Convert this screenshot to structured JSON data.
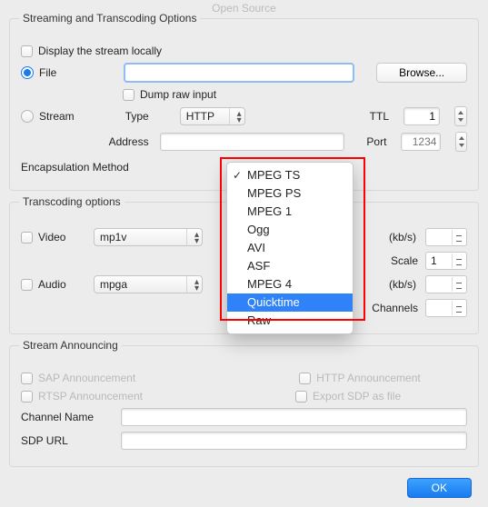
{
  "title": "Open Source",
  "stream_group": {
    "legend": "Streaming and Transcoding Options",
    "display_locally": "Display the stream locally",
    "file_label": "File",
    "browse": "Browse...",
    "dump_raw": "Dump raw input",
    "stream_label": "Stream",
    "type_label": "Type",
    "type_value": "HTTP",
    "ttl_label": "TTL",
    "ttl_value": "1",
    "address_label": "Address",
    "port_label": "Port",
    "port_placeholder": "1234",
    "encap_label": "Encapsulation Method"
  },
  "encap_menu": {
    "items": [
      "MPEG TS",
      "MPEG PS",
      "MPEG 1",
      "Ogg",
      "AVI",
      "ASF",
      "MPEG 4",
      "Quicktime",
      "Raw"
    ],
    "selected": "MPEG TS",
    "highlighted": "Quicktime"
  },
  "transcode_group": {
    "legend": "Transcoding options",
    "video_label": "Video",
    "video_codec": "mp1v",
    "audio_label": "Audio",
    "audio_codec": "mpga",
    "kbps": "(kb/s)",
    "scale": "Scale",
    "scale_value": "1",
    "channels": "Channels"
  },
  "announce_group": {
    "legend": "Stream Announcing",
    "sap": "SAP Announcement",
    "rtsp": "RTSP Announcement",
    "http": "HTTP Announcement",
    "export": "Export SDP as file",
    "channel_name": "Channel Name",
    "sdp_url": "SDP URL"
  },
  "ok": "OK"
}
